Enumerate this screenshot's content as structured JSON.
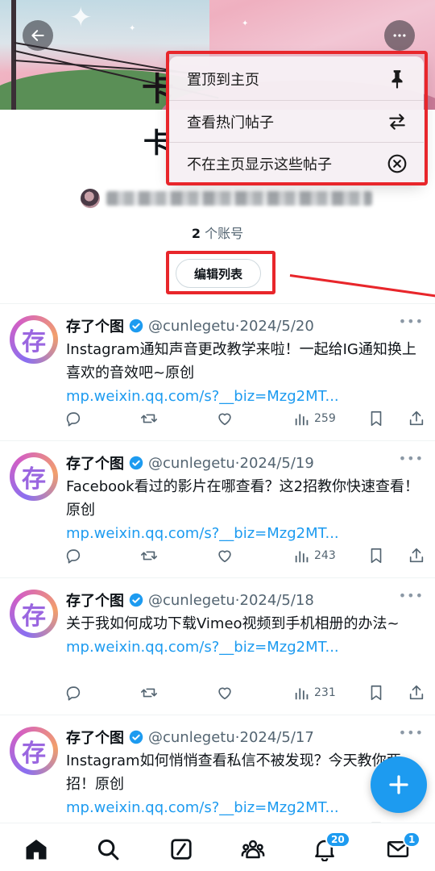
{
  "header": {
    "back_icon": "arrow-left-icon",
    "more_icon": "more-horizontal-icon",
    "banner_glyph": "卡"
  },
  "menu": {
    "items": [
      {
        "label": "置顶到主页",
        "icon": "pin-icon"
      },
      {
        "label": "查看热门帖子",
        "icon": "swap-arrows-icon"
      },
      {
        "label": "不在主页显示这些帖子",
        "icon": "close-circle-icon"
      }
    ]
  },
  "list": {
    "title": "卡",
    "account_count_num": "2",
    "account_count_suffix": " 个账号",
    "edit_button": "编辑列表"
  },
  "tweets": [
    {
      "name": "存了个图",
      "handle": "@cunlegetu",
      "date": "2024/5/20",
      "text": "Instagram通知声音更改教学来啦！一起给IG通知换上喜欢的音效吧~原创",
      "link": "mp.weixin.qq.com/s?__biz=Mzg2MT...",
      "views": "259"
    },
    {
      "name": "存了个图",
      "handle": "@cunlegetu",
      "date": "2024/5/19",
      "text": "Facebook看过的影片在哪查看？这2招教你快速查看！原创",
      "link": "mp.weixin.qq.com/s?__biz=Mzg2MT...",
      "views": "243"
    },
    {
      "name": "存了个图",
      "handle": "@cunlegetu",
      "date": "2024/5/18",
      "text": "关于我如何成功下载Vimeo视频到手机相册的办法~",
      "link": "mp.weixin.qq.com/s?__biz=Mzg2MT...",
      "views": "231"
    },
    {
      "name": "存了个图",
      "handle": "@cunlegetu",
      "date": "2024/5/17",
      "text": "Instagram如何悄悄查看私信不被发现？今天教你两招！原创",
      "link": "mp.weixin.qq.com/s?__biz=Mzg2MT...",
      "views": ""
    }
  ],
  "tweet_separator": "·",
  "more_dots": "•••",
  "fab": {
    "icon": "plus-icon"
  },
  "bottom_nav": {
    "items": [
      {
        "icon": "home-icon"
      },
      {
        "icon": "search-icon"
      },
      {
        "icon": "grok-icon"
      },
      {
        "icon": "communities-icon"
      },
      {
        "icon": "bell-icon",
        "badge": "20"
      },
      {
        "icon": "mail-icon",
        "badge": "1"
      }
    ]
  },
  "colors": {
    "accent": "#1d9bf0",
    "annotation_red": "#e8262b",
    "text_primary": "#0f1419",
    "text_secondary": "#536471"
  }
}
